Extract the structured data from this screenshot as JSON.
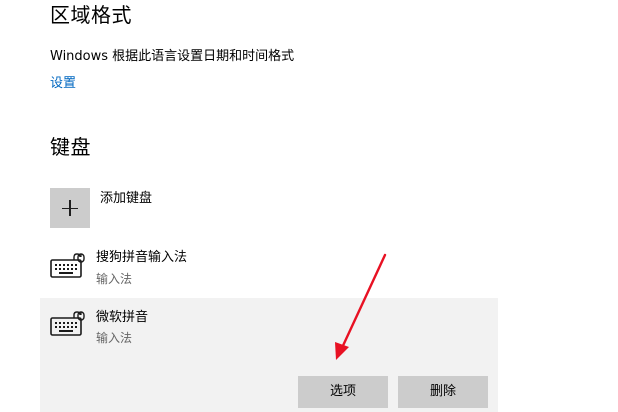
{
  "region_format": {
    "title": "区域格式",
    "description": "Windows 根据此语言设置日期和时间格式",
    "settings_link": "设置"
  },
  "keyboard": {
    "title": "键盘",
    "add_label": "添加键盘",
    "items": [
      {
        "name": "搜狗拼音输入法",
        "type": "输入法",
        "icon": "keyboard-icon",
        "selected": false
      },
      {
        "name": "微软拼音",
        "type": "输入法",
        "icon": "keyboard-icon",
        "selected": true
      }
    ],
    "options_button": "选项",
    "remove_button": "删除"
  },
  "colors": {
    "link": "#0067c0",
    "selected_background": "#f2f2f2",
    "button_background": "#cccccc",
    "annotation_arrow": "#e81123"
  }
}
